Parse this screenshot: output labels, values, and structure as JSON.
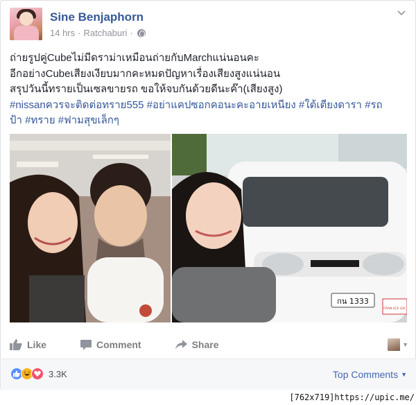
{
  "post": {
    "author_name": "Sine Benjaphorn",
    "time": "14 hrs",
    "separator": "·",
    "location": "Ratchaburi",
    "privacy_icon": "globe-icon",
    "text_lines": [
      "ถ่ายรูปคู่Cubeไม่มีดราม่าเหมือนถ่ายกับMarchแน่นอนคะ",
      "อีกอย่างCubeเสียงเงียบมากคะหมดปัญหาเรื่องเสียงสูงแน่นอน",
      "สรุปวันนี้ทรายเป็นเซลขายรถ ขอให้จบกันด้วยดีนะค๊า(เสียงสูง)"
    ],
    "hashtag_lines": [
      "#nissanควรจะติดต่อทราย555 #อย่าแคปซอกคอนะคะอายเหนียง #ใต้เตียงดารา #รถ",
      "ป้า #ทราย #ฟามสุขเล็กๆ"
    ],
    "plate_text": "กน 1333",
    "plate_frame_text": "FRAN LEX LEK"
  },
  "actions": {
    "like_label": "Like",
    "comment_label": "Comment",
    "share_label": "Share"
  },
  "footer": {
    "reaction_count": "3.3K",
    "top_comments_label": "Top Comments"
  },
  "colors": {
    "author": "#365899",
    "hashtag": "#365899",
    "action_text": "#7f7f7f",
    "like": "#5890ff",
    "haha": "#f7b125",
    "love": "#f25268"
  },
  "watermark": "[762x719]https://upic.me/"
}
